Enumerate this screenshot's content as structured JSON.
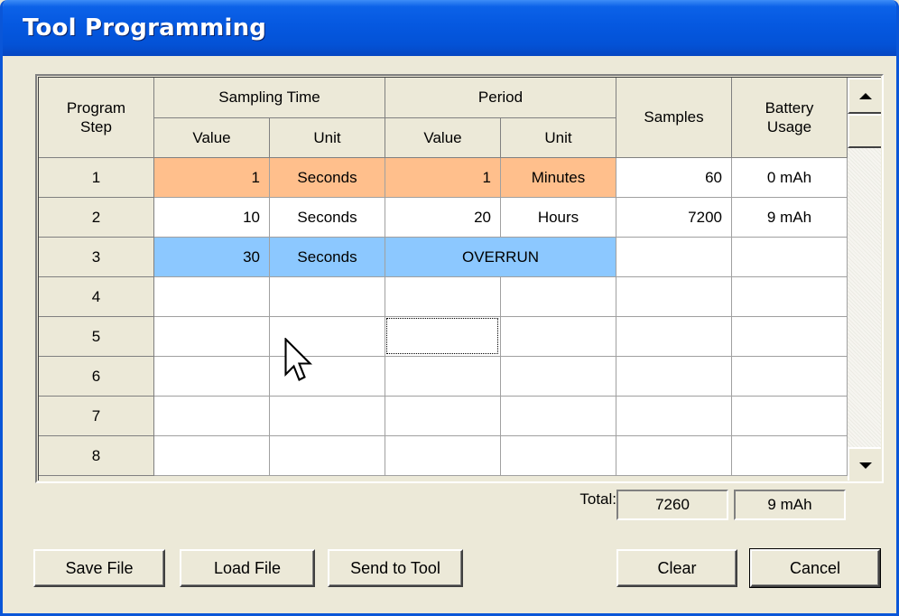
{
  "window": {
    "title": "Tool Programming"
  },
  "grid": {
    "headers": {
      "program_step": [
        "Program",
        "Step"
      ],
      "sampling_time": "Sampling Time",
      "period": "Period",
      "samples": "Samples",
      "battery_usage": [
        "Battery",
        "Usage"
      ],
      "value": "Value",
      "unit": "Unit"
    },
    "rows": [
      {
        "step": "1",
        "st_value": "1",
        "st_unit": "Seconds",
        "p_value": "1",
        "p_unit": "Minutes",
        "samples": "60",
        "battery": "0 mAh",
        "highlight": "orange"
      },
      {
        "step": "2",
        "st_value": "10",
        "st_unit": "Seconds",
        "p_value": "20",
        "p_unit": "Hours",
        "samples": "7200",
        "battery": "9 mAh",
        "highlight": "none"
      },
      {
        "step": "3",
        "st_value": "30",
        "st_unit": "Seconds",
        "p_overrun": "OVERRUN",
        "samples": "",
        "battery": "",
        "highlight": "blue"
      },
      {
        "step": "4"
      },
      {
        "step": "5"
      },
      {
        "step": "6"
      },
      {
        "step": "7"
      },
      {
        "step": "8"
      }
    ],
    "colors": {
      "orange": "#FFBF8C",
      "blue": "#8CC8FF"
    }
  },
  "totals": {
    "label": "Total:",
    "samples": "7260",
    "battery": "9 mAh"
  },
  "buttons": {
    "save_file": "Save File",
    "load_file": "Load File",
    "send_to_tool": "Send to Tool",
    "clear": "Clear",
    "cancel": "Cancel"
  },
  "icons": {
    "scroll_up": "triangle-up-icon",
    "scroll_down": "triangle-down-icon",
    "cursor": "mouse-pointer-icon"
  }
}
